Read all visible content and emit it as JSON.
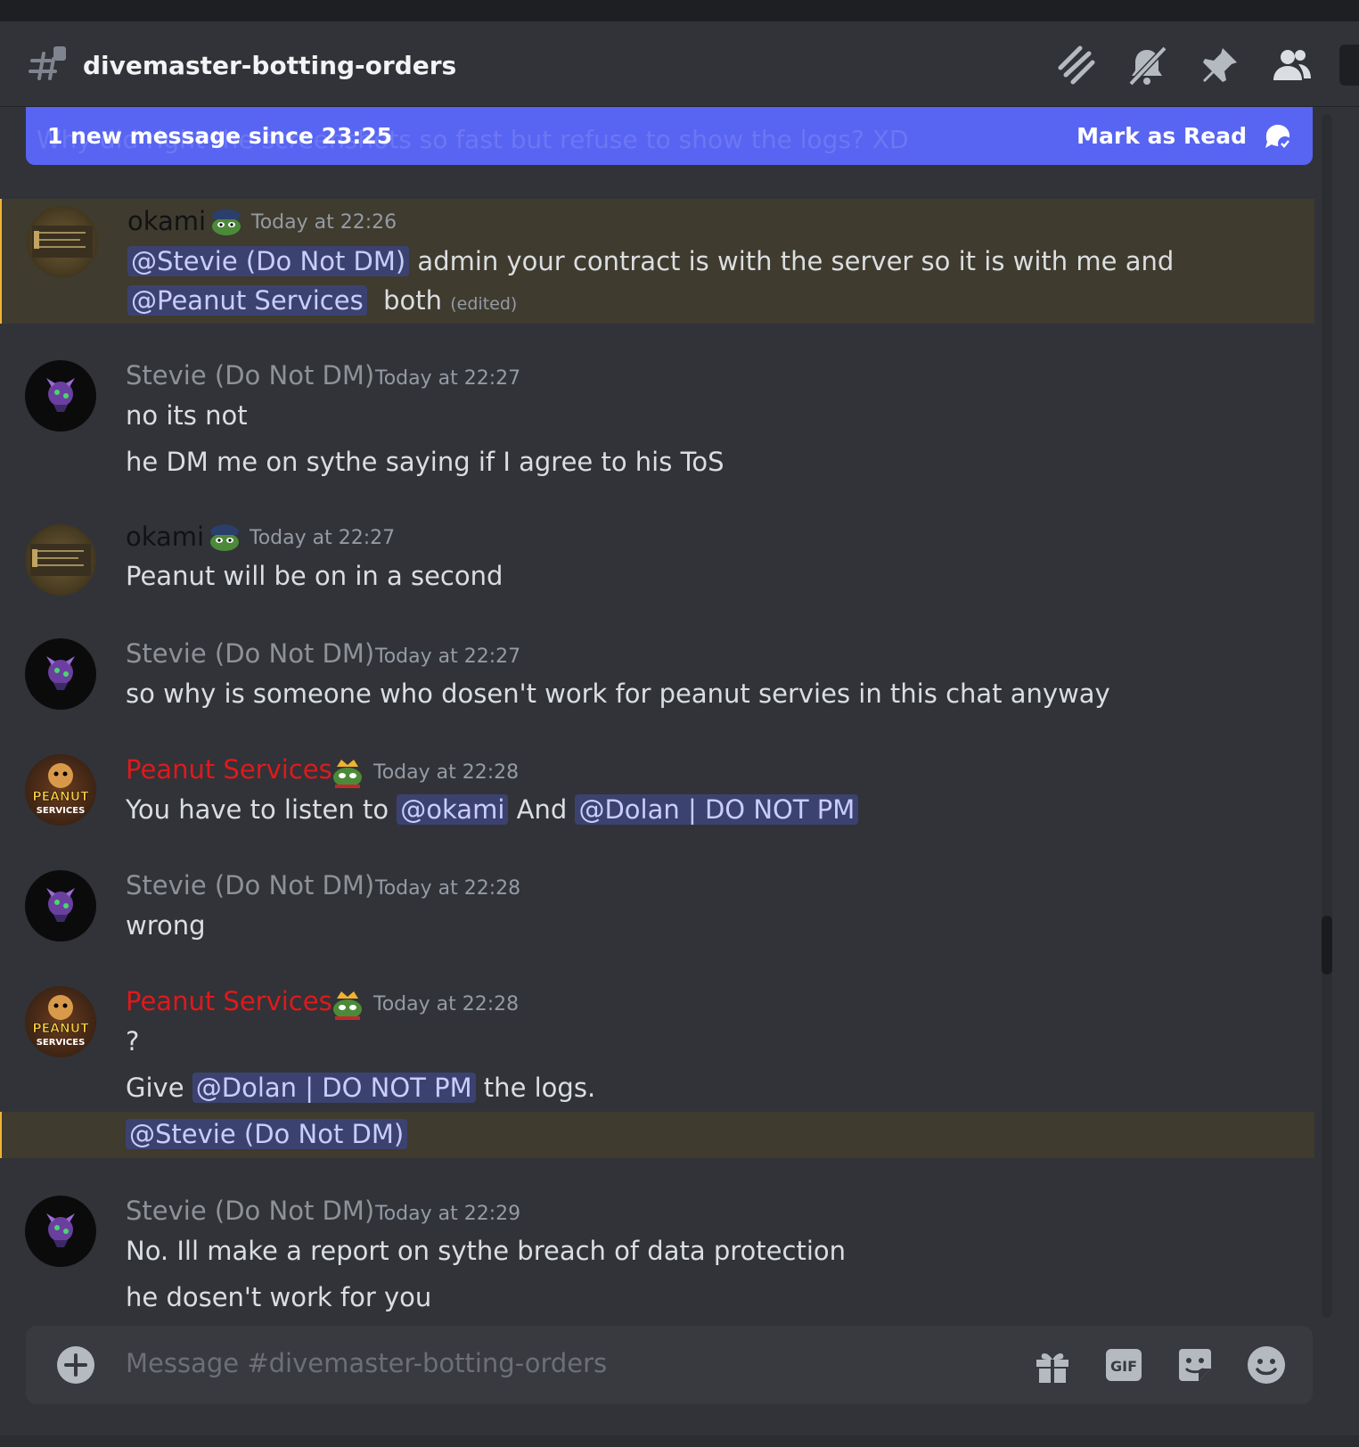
{
  "channel": {
    "name": "divemaster-botting-orders"
  },
  "header_icons": [
    "threads-icon",
    "mute-bell-icon",
    "pin-icon",
    "members-icon"
  ],
  "banner": {
    "text": "1 new message since 23:25",
    "mark_read": "Mark as Read",
    "ghost_text": "Why did right the screenshots so fast but refuse to show the logs? XD"
  },
  "messages": [
    {
      "author": "okami",
      "author_color": "#111214",
      "timestamp": "Today at 22:26",
      "line1": {
        "mention1": "@Stevie (Do Not DM)",
        "text1": " admin your contract is with the server so it is with me and"
      },
      "line2": {
        "mention1": "@Peanut Services",
        "text1": "  both ",
        "edited": "(edited)"
      }
    },
    {
      "author": "Stevie (Do Not DM)",
      "author_color": "#8e9297",
      "timestamp": "Today at 22:27",
      "lines": [
        "no its not",
        "he DM me on sythe saying if I agree to his ToS"
      ]
    },
    {
      "author": "okami",
      "author_color": "#111214",
      "timestamp": "Today at 22:27",
      "lines": [
        "Peanut will be on in a second"
      ]
    },
    {
      "author": "Stevie (Do Not DM)",
      "author_color": "#8e9297",
      "timestamp": "Today at 22:27",
      "lines": [
        "so why is someone who dosen't work for peanut servies in this chat anyway"
      ]
    },
    {
      "author": "Peanut Services",
      "author_color": "#e0191b",
      "timestamp": "Today at 22:28",
      "line1": {
        "text1": "You have to listen to ",
        "mention1": "@okami",
        "text2": " And ",
        "mention2": "@Dolan | DO NOT PM"
      }
    },
    {
      "author": "Stevie (Do Not DM)",
      "author_color": "#8e9297",
      "timestamp": "Today at 22:28",
      "lines": [
        "wrong"
      ]
    },
    {
      "author": "Peanut Services",
      "author_color": "#e0191b",
      "timestamp": "Today at 22:28",
      "line1": "?",
      "line2": {
        "text1": "Give ",
        "mention1": "@Dolan | DO NOT PM",
        "text2": " the logs."
      },
      "line3": {
        "mention1": "@Stevie (Do Not DM)"
      }
    },
    {
      "author": "Stevie (Do Not DM)",
      "author_color": "#8e9297",
      "timestamp": "Today at 22:29",
      "lines": [
        "No. Ill make a report on sythe breach of data protection",
        "he dosen't work for you"
      ]
    }
  ],
  "avatar_text": {
    "peanut_top": "PEANUT",
    "peanut_bottom": "SERVICES"
  },
  "composer": {
    "placeholder": "Message #divemaster-botting-orders",
    "gif_label": "GIF"
  },
  "colors": {
    "accent": "#5865f2",
    "mention_bg": "#3c4270",
    "highlight_bg": "#3f3b2e",
    "highlight_bar": "#f0b232"
  }
}
